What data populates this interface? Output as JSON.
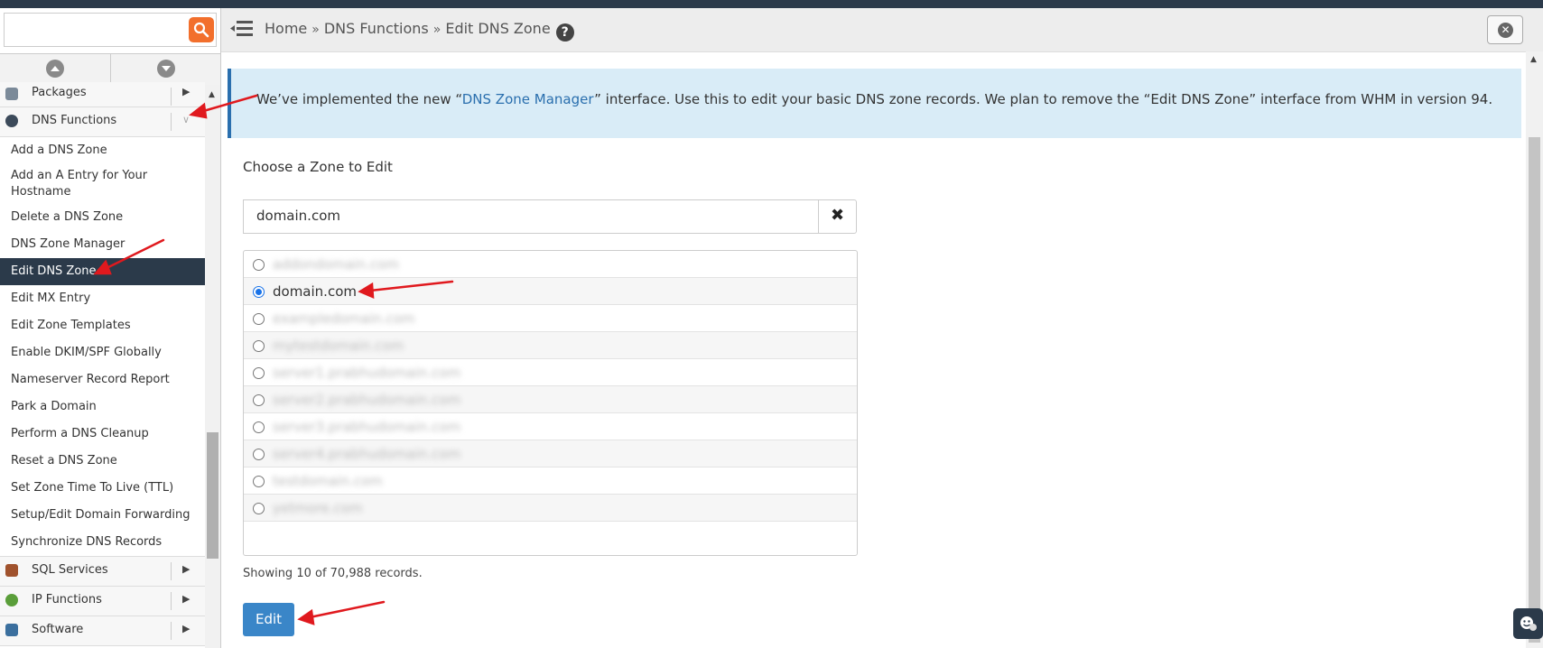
{
  "header": {
    "breadcrumb": {
      "home": "Home",
      "sep1": "»",
      "section": "DNS Functions",
      "sep2": "»",
      "page": "Edit DNS Zone"
    },
    "help_glyph": "?",
    "close_glyph": "✕"
  },
  "sidebar": {
    "search": {
      "value": "",
      "placeholder": ""
    },
    "categories": {
      "packages": "Packages",
      "dns_functions": "DNS Functions",
      "sql_services": "SQL Services",
      "ip_functions": "IP Functions",
      "software": "Software"
    },
    "dns_items": [
      "Add a DNS Zone",
      "Add an A Entry for Your Hostname",
      "Delete a DNS Zone",
      "DNS Zone Manager",
      "Edit DNS Zone",
      "Edit MX Entry",
      "Edit Zone Templates",
      "Enable DKIM/SPF Globally",
      "Nameserver Record Report",
      "Park a Domain",
      "Perform a DNS Cleanup",
      "Reset a DNS Zone",
      "Set Zone Time To Live (TTL)",
      "Setup/Edit Domain Forwarding",
      "Synchronize DNS Records"
    ],
    "active_item": "Edit DNS Zone"
  },
  "notice": {
    "before": "We’ve implemented the new “",
    "link": "DNS Zone Manager",
    "after": "” interface. Use this to edit your basic DNS zone records. We plan to remove the “Edit DNS Zone” interface from WHM in version 94."
  },
  "main": {
    "choose_label": "Choose a Zone to Edit",
    "zone_input_value": "domain.com",
    "clear_glyph": "✖",
    "zones": [
      {
        "name": "addondomain.com",
        "selected": false,
        "blurred": true
      },
      {
        "name": "domain.com",
        "selected": true,
        "blurred": false
      },
      {
        "name": "exampledomain.com",
        "selected": false,
        "blurred": true
      },
      {
        "name": "mytestdomain.com",
        "selected": false,
        "blurred": true
      },
      {
        "name": "server1.prabhudomain.com",
        "selected": false,
        "blurred": true
      },
      {
        "name": "server2.prabhudomain.com",
        "selected": false,
        "blurred": true
      },
      {
        "name": "server3.prabhudomain.com",
        "selected": false,
        "blurred": true
      },
      {
        "name": "server4.prabhudomain.com",
        "selected": false,
        "blurred": true
      },
      {
        "name": "testdomain.com",
        "selected": false,
        "blurred": true
      },
      {
        "name": "yetmore.com",
        "selected": false,
        "blurred": true
      }
    ],
    "showing": "Showing 10 of 70,988 records.",
    "edit_label": "Edit"
  },
  "colors": {
    "accent": "#f26f2c",
    "navy": "#2b3a4a",
    "link": "#2a6fae",
    "notice_bg": "#d9ecf7",
    "button": "#3a86c8",
    "annotation_arrow": "#e0191e"
  }
}
